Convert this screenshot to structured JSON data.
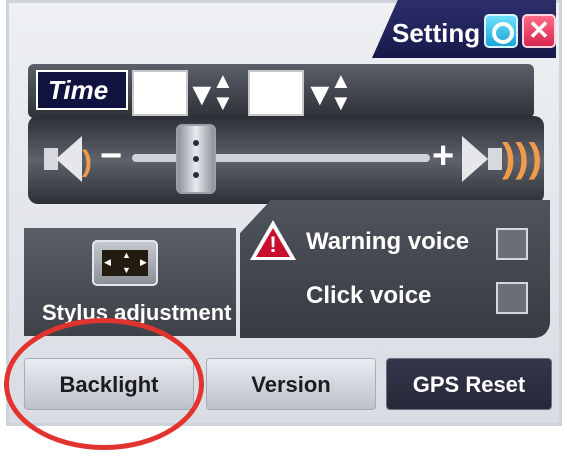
{
  "header": {
    "title": "Setting"
  },
  "time": {
    "label": "Time",
    "hour_value": "",
    "minute_value": ""
  },
  "volume": {
    "minus": "−",
    "plus": "+",
    "waves": ")))"
  },
  "stylus": {
    "label": "Stylus adjustment"
  },
  "options": {
    "warning_voice": {
      "label": "Warning voice",
      "checked": false
    },
    "click_voice": {
      "label": "Click voice",
      "checked": false
    }
  },
  "buttons": {
    "backlight": "Backlight",
    "version": "Version",
    "gps_reset": "GPS Reset"
  },
  "colors": {
    "title_bg": "#1c1d52",
    "accent_cyan": "#1aa4d8",
    "close_pink": "#d6274f",
    "highlight_red": "#e3332f",
    "panel_dark": "#3e4148"
  },
  "icons": [
    "settings-icon",
    "close-icon",
    "speaker-low-icon",
    "speaker-high-icon",
    "stylus-icon",
    "warning-icon"
  ]
}
